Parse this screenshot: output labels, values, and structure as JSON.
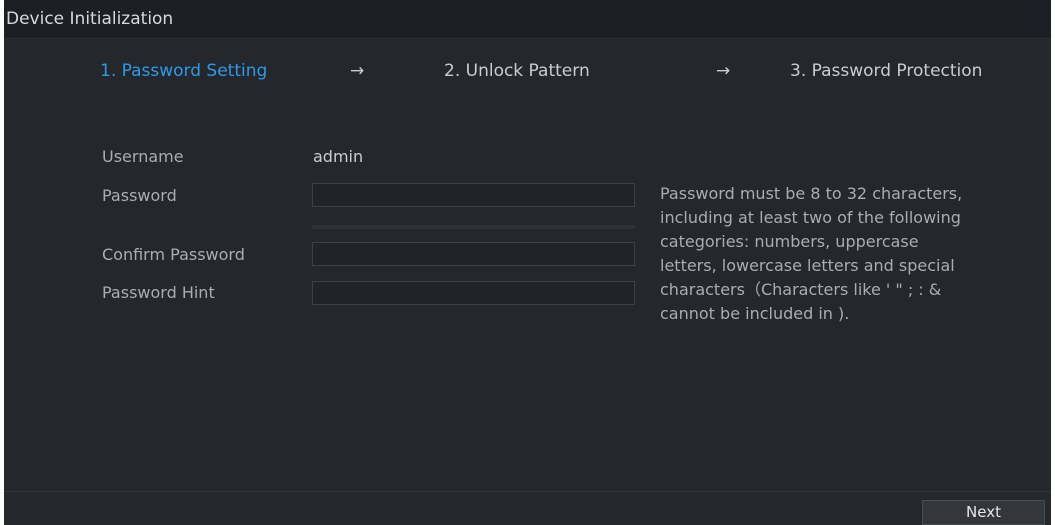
{
  "window": {
    "title": "Device Initialization"
  },
  "steps": [
    {
      "label": "1. Password Setting",
      "active": true
    },
    {
      "label": "2. Unlock Pattern",
      "active": false
    },
    {
      "label": "3. Password Protection",
      "active": false
    }
  ],
  "step_arrow": "→",
  "form": {
    "username_label": "Username",
    "username_value": "admin",
    "password_label": "Password",
    "password_value": "",
    "confirm_label": "Confirm Password",
    "confirm_value": "",
    "hint_label": "Password Hint",
    "hint_value": ""
  },
  "help_text": [
    "Password must be 8 to 32 characters,",
    "including at least two of the following",
    "categories: numbers, uppercase",
    "letters, lowercase letters and special",
    "characters（Characters like ' \" ; : &",
    "cannot be included in )."
  ],
  "buttons": {
    "next": "Next"
  },
  "colors": {
    "background": "#24272c",
    "active_step": "#2e9be6",
    "text": "#c9ccd0"
  }
}
